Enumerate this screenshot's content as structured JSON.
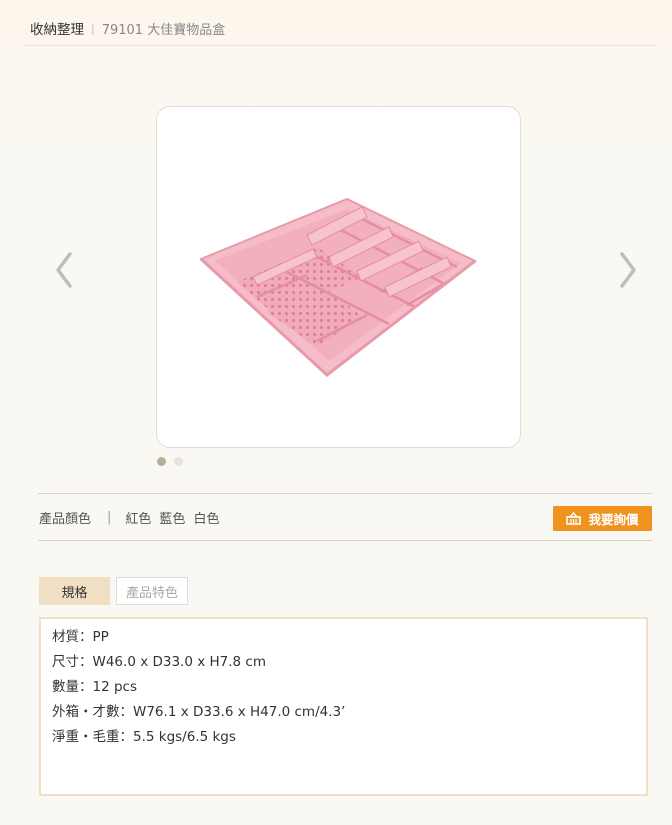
{
  "breadcrumb": {
    "category": "收納整理",
    "separator": "|",
    "current": "79101 大佳寶物品盒"
  },
  "gallery": {
    "image_alt": "pink drawer organizer tray product photo",
    "dots_total": 2,
    "active_dot": 1
  },
  "colors": {
    "label": "產品顏色",
    "separator": "|",
    "options": [
      "紅色",
      "藍色",
      "白色"
    ]
  },
  "inquiry_button": "我要詢價",
  "tabs": [
    "規格",
    "產品特色"
  ],
  "specs": [
    "材質：PP",
    "尺寸：W46.0 x D33.0 x H7.8 cm",
    "數量：12 pcs",
    "外箱・才數：W76.1 x D33.6 x H47.0 cm/4.3’",
    "淨重・毛重：5.5 kgs/6.5 kgs"
  ],
  "theme": {
    "accent": "#f0921e",
    "tab_active_bg": "#f1dfc3",
    "spec_border": "#efdfc4",
    "product_pink": "#f4b3c0"
  }
}
